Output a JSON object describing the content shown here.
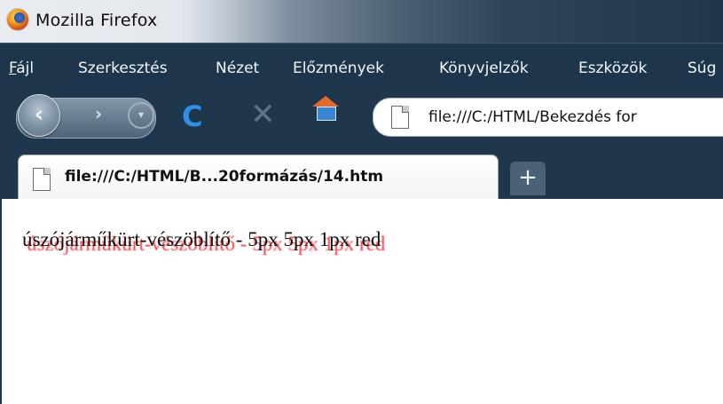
{
  "window": {
    "title": "Mozilla Firefox"
  },
  "menu": {
    "items": [
      "Fájl",
      "Szerkesztés",
      "Nézet",
      "Előzmények",
      "Könyvjelzők",
      "Eszközök",
      "Súg"
    ]
  },
  "toolbar": {
    "back_icon": "back-arrow-icon",
    "forward_icon": "forward-arrow-icon",
    "reload_icon": "reload-icon",
    "stop_icon": "stop-icon",
    "home_icon": "home-icon",
    "url": "file:///C:/HTML/Bekezdés for"
  },
  "tabs": {
    "active_title": "file:///C:/HTML/B...20formázás/14.htm",
    "new_tab_label": "+"
  },
  "content": {
    "text": "úszójárműkürt-vészöblítő - 5px 5px 1px red",
    "text_shadow_color": "#e5000a"
  }
}
